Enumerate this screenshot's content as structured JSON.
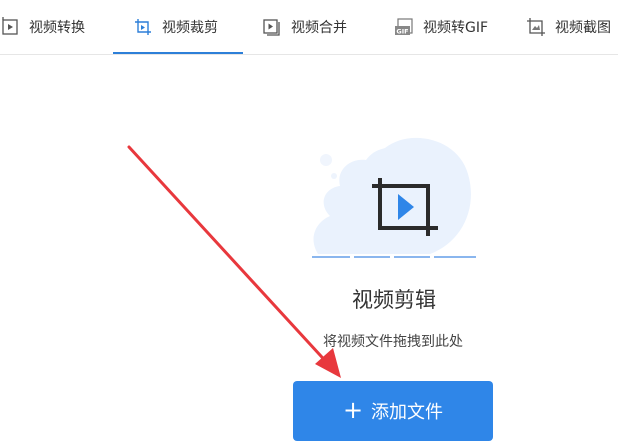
{
  "tabs": [
    {
      "label": "视频转换",
      "icon": "video-convert-icon",
      "active": false
    },
    {
      "label": "视频裁剪",
      "icon": "video-crop-icon",
      "active": true
    },
    {
      "label": "视频合并",
      "icon": "video-merge-icon",
      "active": false
    },
    {
      "label": "视频转GIF",
      "icon": "video-to-gif-icon",
      "active": false
    },
    {
      "label": "视频截图",
      "icon": "video-screenshot-icon",
      "active": false
    }
  ],
  "main": {
    "title": "视频剪辑",
    "subtitle": "将视频文件拖拽到此处",
    "add_button_label": "添加文件",
    "icon": "crop-play-icon"
  },
  "colors": {
    "accent": "#2f86e8",
    "annotation_arrow": "#e8383d",
    "illustration_bg": "#eaf2fd"
  }
}
